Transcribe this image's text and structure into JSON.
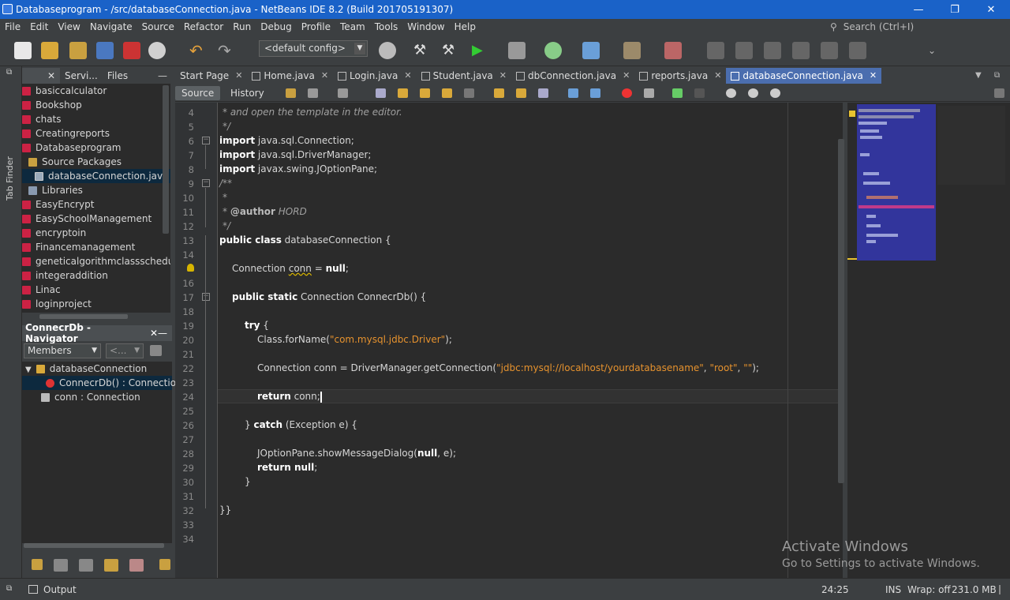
{
  "window": {
    "title": "Databaseprogram - /src/databaseConnection.java - NetBeans IDE 8.2 (Build 201705191307)",
    "minimize": "—",
    "maximize": "❐",
    "close": "✕"
  },
  "menu": {
    "items": [
      "File",
      "Edit",
      "View",
      "Navigate",
      "Source",
      "Refactor",
      "Run",
      "Debug",
      "Profile",
      "Team",
      "Tools",
      "Window",
      "Help"
    ]
  },
  "search": {
    "placeholder": "Search (Ctrl+I)"
  },
  "toolbar": {
    "config": "<default config>"
  },
  "left_strip": {
    "label": "Tab Finder"
  },
  "projects_panel": {
    "tabs": [
      {
        "label": "Servi..."
      },
      {
        "label": "Files"
      }
    ],
    "items": [
      {
        "label": "basiccalculator",
        "level": 0
      },
      {
        "label": "Bookshop",
        "level": 0
      },
      {
        "label": "chats",
        "level": 0
      },
      {
        "label": "Creatingreports",
        "level": 0
      },
      {
        "label": "Databaseprogram",
        "level": 0
      },
      {
        "label": "Source Packages",
        "level": 1
      },
      {
        "label": "databaseConnection.java",
        "level": 2,
        "selected": true
      },
      {
        "label": "Libraries",
        "level": 1
      },
      {
        "label": "EasyEncrypt",
        "level": 0
      },
      {
        "label": "EasySchoolManagement",
        "level": 0
      },
      {
        "label": "encryptoin",
        "level": 0
      },
      {
        "label": "Financemanagement",
        "level": 0
      },
      {
        "label": "geneticalgorithmclassschedu",
        "level": 0
      },
      {
        "label": "integeraddition",
        "level": 0
      },
      {
        "label": "Linac",
        "level": 0
      },
      {
        "label": "loginproject",
        "level": 0
      }
    ]
  },
  "navigator": {
    "title": "ConnecrDb - Navigator",
    "filter": "Members",
    "filter2": "<...",
    "items": [
      {
        "label": "databaseConnection",
        "level": 0
      },
      {
        "label": "ConnecrDb() : Connection",
        "level": 1,
        "selected": true
      },
      {
        "label": "conn : Connection",
        "level": 1
      }
    ]
  },
  "editor_tabs": [
    {
      "label": "Start Page",
      "active": false
    },
    {
      "label": "Home.java",
      "active": false
    },
    {
      "label": "Login.java",
      "active": false
    },
    {
      "label": "Student.java",
      "active": false
    },
    {
      "label": "dbConnection.java",
      "active": false
    },
    {
      "label": "reports.java",
      "active": false
    },
    {
      "label": "databaseConnection.java",
      "active": true
    }
  ],
  "editor_modes": {
    "source": "Source",
    "history": "History"
  },
  "code": {
    "line_numbers": [
      "4",
      "5",
      "6",
      "7",
      "8",
      "9",
      "10",
      "11",
      "12",
      "13",
      "14",
      "15",
      "16",
      "17",
      "18",
      "19",
      "20",
      "21",
      "22",
      "23",
      "24",
      "25",
      "26",
      "27",
      "28",
      "29",
      "30",
      "31",
      "32",
      "33",
      "34"
    ],
    "l4": "* and open the template in the editor.",
    "l5": "*/",
    "l6a": "import",
    "l6b": " java.sql.Connection;",
    "l7a": "import",
    "l7b": " java.sql.DriverManager;",
    "l8a": "import",
    "l8b": " javax.swing.JOptionPane;",
    "l9": "/**",
    "l10": "*",
    "l11a": "* ",
    "l11b": "@author",
    "l11c": " HORD",
    "l12": "*/",
    "l13a": "public class",
    "l13b": " databaseConnection {",
    "l15a": "Connection ",
    "l15b": "conn",
    "l15c": " = ",
    "l15d": "null",
    "l15e": ";",
    "l17a": "public static",
    "l17b": " Connection ConnecrDb() {",
    "l19a": "try",
    "l19b": " {",
    "l20a": "Class.forName(",
    "l20b": "\"com.mysql.jdbc.Driver\"",
    "l20c": ");",
    "l22a": "Connection conn = DriverManager.getConnection(",
    "l22b": "\"jdbc:mysql://localhost/yourdatabasename\"",
    "l22c": ", ",
    "l22d": "\"root\"",
    "l22e": ", ",
    "l22f": "\"\"",
    "l22g": ");",
    "l24a": "return",
    "l24b": " conn;",
    "l26a": "} ",
    "l26b": "catch",
    "l26c": " (Exception e) {",
    "l28a": "JOptionPane.showMessageDialog(",
    "l28b": "null",
    "l28c": ", e);",
    "l29a": "return",
    "l29b": " null",
    "l29c": ";",
    "l30": "}",
    "l32": "}}"
  },
  "status": {
    "output": "Output",
    "position": "24:25",
    "mode": "INS",
    "wrap": "Wrap: off",
    "memory": "231.0 MB"
  },
  "watermark": {
    "line1": "Activate Windows",
    "line2": "Go to Settings to activate Windows."
  },
  "colors": {
    "titlebar": "#1a62c8",
    "active_tab": "#4b6eaf",
    "selection": "#0d293e",
    "string": "#e6922e",
    "minimap_view": "#3336a8"
  }
}
